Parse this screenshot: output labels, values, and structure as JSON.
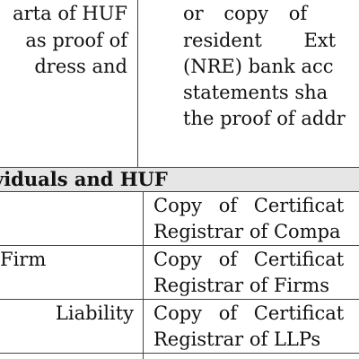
{
  "top_left_cell": {
    "lines": [
      "arta of HUF",
      "as proof of",
      "dress and"
    ]
  },
  "top_right_cell": {
    "lines": [
      "or copy of",
      "resident Ext",
      "(NRE) bank acc",
      "statements sha",
      "the proof of addr"
    ]
  },
  "section": {
    "title": "viduals and HUF"
  },
  "rows": [
    {
      "left_lines": [
        ""
      ],
      "right_lines": [
        "Copy of Certificat",
        "Registrar of Compa"
      ]
    },
    {
      "left_lines": [
        "Firm"
      ],
      "right_lines": [
        "Copy of Certificat",
        "Registrar of Firms"
      ]
    },
    {
      "left_lines": [
        "Liability"
      ],
      "right_lines": [
        "Copy of Certificat",
        "Registrar of LLPs"
      ]
    }
  ]
}
